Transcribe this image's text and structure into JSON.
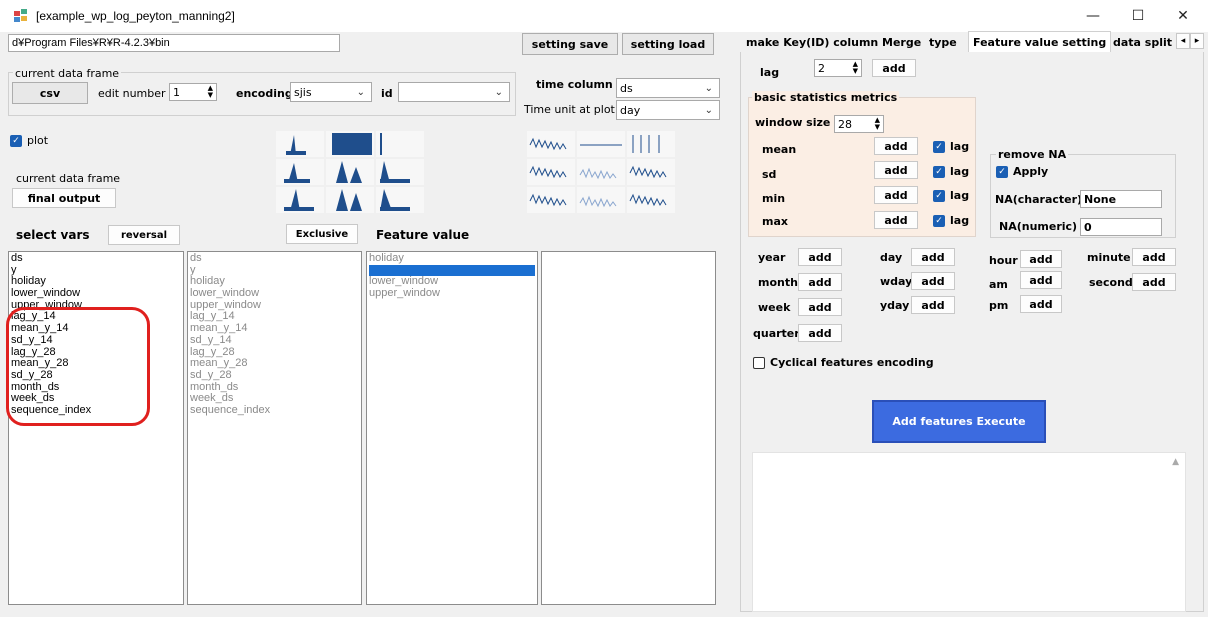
{
  "window": {
    "title": "[example_wp_log_peyton_manning2]",
    "minimize": "—",
    "maximize": "☐",
    "close": "✕"
  },
  "path": "d¥Program Files¥R¥R-4.2.3¥bin",
  "buttons": {
    "setting_save": "setting save",
    "setting_load": "setting load",
    "csv": "csv",
    "final_output": "final output",
    "reversal": "reversal",
    "exclusive": "Exclusive",
    "execute": "Add features Execute"
  },
  "data_frame": {
    "group_label": "current data frame",
    "edit_number_label": "edit number",
    "edit_number": "1",
    "encoding_label": "encoding",
    "encoding": "sjis",
    "id_label": "id",
    "id_value": "",
    "time_column_label": "time column",
    "time_column": "ds",
    "time_unit_label": "Time unit at plot",
    "time_unit": "day"
  },
  "plot": {
    "label": "plot",
    "checked": true,
    "current_frame_label": "current data frame"
  },
  "select_vars_label": "select vars",
  "feature_value_label": "Feature value",
  "list1": [
    "ds",
    "y",
    "holiday",
    "lower_window",
    "upper_window",
    "lag_y_14",
    "mean_y_14",
    "sd_y_14",
    "lag_y_28",
    "mean_y_28",
    "sd_y_28",
    "month_ds",
    "week_ds",
    "sequence_index"
  ],
  "list2": [
    "ds",
    "y",
    "holiday",
    "lower_window",
    "upper_window",
    "lag_y_14",
    "mean_y_14",
    "sd_y_14",
    "lag_y_28",
    "mean_y_28",
    "sd_y_28",
    "month_ds",
    "week_ds",
    "sequence_index"
  ],
  "list3": [
    "holiday",
    "",
    "lower_window",
    "upper_window"
  ],
  "tabs": [
    {
      "label": "make Key(ID) column",
      "active": false
    },
    {
      "label": "Merge",
      "active": false
    },
    {
      "label": "type",
      "active": false
    },
    {
      "label": "Feature value setting",
      "active": true
    },
    {
      "label": "data split",
      "active": false
    }
  ],
  "tab_scroll": {
    "left": "◂",
    "right": "▸"
  },
  "feature": {
    "lag_label": "lag",
    "lag_value": "2",
    "add": "add",
    "basic_stats_label": "basic statistics metrics",
    "window_size_label": "window size",
    "window_size": "28",
    "stats": [
      {
        "label": "mean",
        "lag_label": "lag",
        "checked": true
      },
      {
        "label": "sd",
        "lag_label": "lag",
        "checked": true
      },
      {
        "label": "min",
        "lag_label": "lag",
        "checked": true
      },
      {
        "label": "max",
        "lag_label": "lag",
        "checked": true
      }
    ],
    "remove_na_label": "remove NA",
    "apply_label": "Apply",
    "apply_checked": true,
    "na_char_label": "NA(character)",
    "na_char_value": "None",
    "na_num_label": "NA(numeric)",
    "na_num_value": "0",
    "time_features": {
      "year": "year",
      "month": "month",
      "week": "week",
      "quarter": "quarter",
      "day": "day",
      "wday": "wday",
      "yday": "yday",
      "hour": "hour",
      "am": "am",
      "pm": "pm",
      "minute": "minute",
      "second": "second"
    },
    "cyclical_label": "Cyclical features encoding",
    "cyclical_checked": false
  },
  "colors": {
    "accent": "#1a5fb4",
    "execute_bg": "#3c6be0",
    "highlight": "#e0201e",
    "stats_bg": "#fbeee4"
  }
}
